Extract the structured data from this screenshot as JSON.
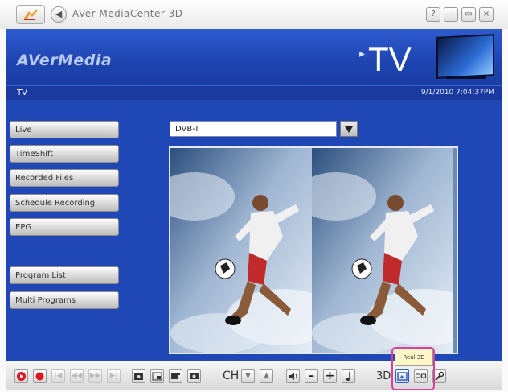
{
  "window": {
    "title": "AVer MediaCenter 3D",
    "buttons": [
      "?",
      "–",
      "▭",
      "×"
    ]
  },
  "header": {
    "brand": "AVerMedia",
    "section": "TV"
  },
  "subbar": {
    "breadcrumb": "TV",
    "datetime": "9/1/2010 7:04:37PM"
  },
  "menu": {
    "items": [
      {
        "label": "Live"
      },
      {
        "label": "TimeShift"
      },
      {
        "label": "Recorded Files"
      },
      {
        "label": "Schedule Recording"
      },
      {
        "label": "EPG"
      },
      {
        "label": "Program List"
      },
      {
        "label": "Multi Programs"
      }
    ]
  },
  "source": {
    "selected": "DVB-T"
  },
  "toolbar": {
    "channel_label": "CH",
    "mode_label": "3D",
    "tooltip": "Real 3D"
  },
  "colors": {
    "panel": "#1f47b5",
    "record": "#e0141e",
    "highlight": "#d8409a"
  }
}
